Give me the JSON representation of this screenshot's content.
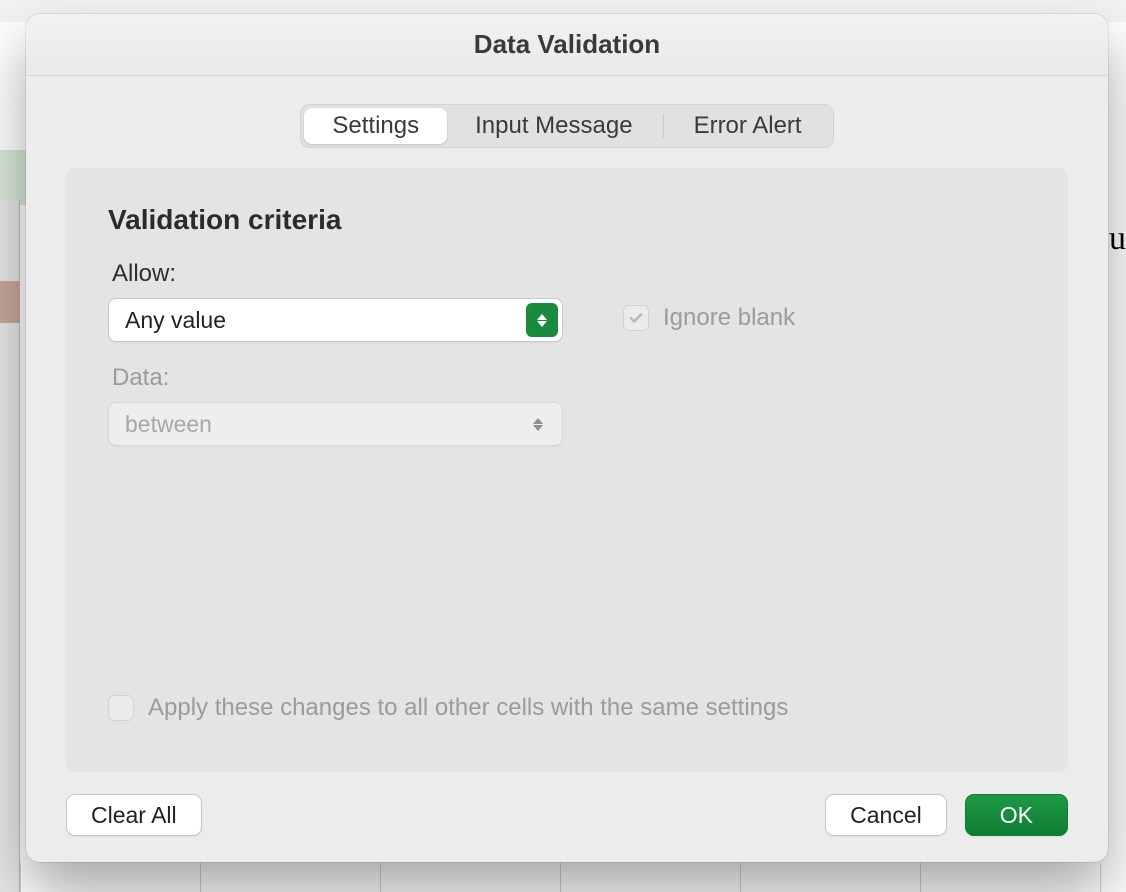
{
  "dialog": {
    "title": "Data Validation",
    "tabs": [
      {
        "label": "Settings"
      },
      {
        "label": "Input Message"
      },
      {
        "label": "Error Alert"
      }
    ],
    "section_title": "Validation criteria",
    "allow_label": "Allow:",
    "allow_value": "Any value",
    "data_label": "Data:",
    "data_value": "between",
    "ignore_blank_label": "Ignore blank",
    "apply_label": "Apply these changes to all other cells with the same settings",
    "buttons": {
      "clear_all": "Clear All",
      "cancel": "Cancel",
      "ok": "OK"
    }
  },
  "colors": {
    "accent_green": "#1a8a3e"
  },
  "background": {
    "partial_text_right": "u"
  }
}
